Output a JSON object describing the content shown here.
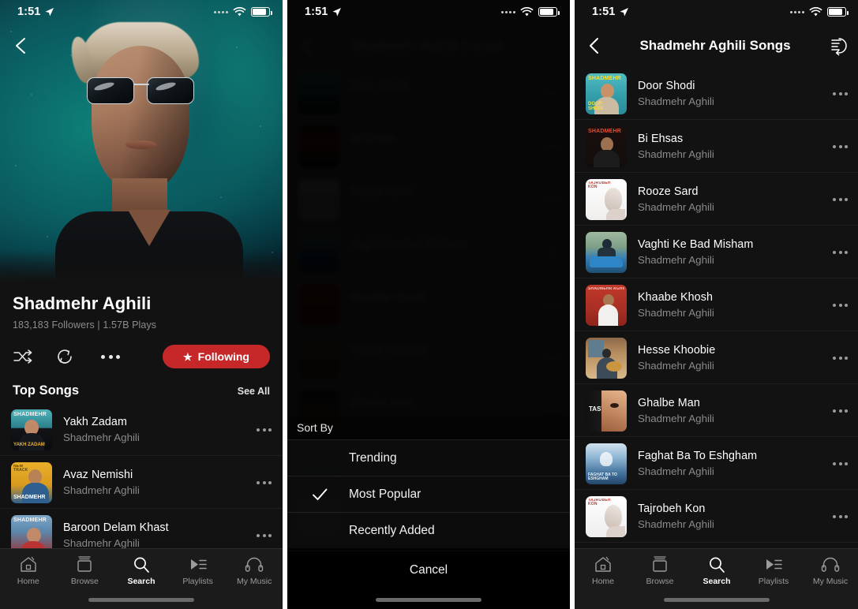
{
  "status_bar": {
    "time": "1:51",
    "location_icon": "location-arrow-icon",
    "wifi_icon": "wifi-icon",
    "battery_icon": "battery-icon"
  },
  "accent": {
    "follow_red": "#c6282a",
    "bg": "#121212",
    "tabbar": "#1b1b1b"
  },
  "panel1": {
    "back_icon": "chevron-left-icon",
    "artist_name": "Shadmehr Aghili",
    "artist_meta": "183,183 Followers | 1.57B Plays",
    "actions": {
      "shuffle_icon": "shuffle-icon",
      "repeat_icon": "repeat-icon",
      "more_icon": "more-options-icon"
    },
    "follow_button": {
      "label": "Following",
      "icon": "star-icon"
    },
    "section_title": "Top Songs",
    "see_all": "See All",
    "songs": [
      {
        "title": "Yakh Zadam",
        "artist": "Shadmehr Aghili"
      },
      {
        "title": "Avaz Nemishi",
        "artist": "Shadmehr Aghili"
      },
      {
        "title": "Baroon Delam Khast",
        "artist": "Shadmehr Aghili"
      }
    ]
  },
  "panel2": {
    "sheet_title": "Sort By",
    "options": [
      {
        "label": "Trending",
        "selected": false
      },
      {
        "label": "Most Popular",
        "selected": true
      },
      {
        "label": "Recently Added",
        "selected": false
      }
    ],
    "cancel": "Cancel"
  },
  "panel3": {
    "back_icon": "chevron-left-icon",
    "title": "Shadmehr Aghili Songs",
    "sort_icon": "sort-icon",
    "songs": [
      {
        "title": "Door Shodi",
        "artist": "Shadmehr Aghili"
      },
      {
        "title": "Bi Ehsas",
        "artist": "Shadmehr Aghili"
      },
      {
        "title": "Rooze Sard",
        "artist": "Shadmehr Aghili"
      },
      {
        "title": "Vaghti Ke Bad Misham",
        "artist": "Shadmehr Aghili"
      },
      {
        "title": "Khaabe Khosh",
        "artist": "Shadmehr Aghili"
      },
      {
        "title": "Hesse Khoobie",
        "artist": "Shadmehr Aghili"
      },
      {
        "title": "Ghalbe Man",
        "artist": "Shadmehr Aghili"
      },
      {
        "title": "Faghat Ba To Eshgham",
        "artist": "Shadmehr Aghili"
      },
      {
        "title": "Tajrobeh Kon",
        "artist": "Shadmehr Aghili"
      }
    ]
  },
  "tabbar": {
    "items": [
      {
        "label": "Home",
        "icon": "home-icon",
        "active": false
      },
      {
        "label": "Browse",
        "icon": "browse-icon",
        "active": false
      },
      {
        "label": "Search",
        "icon": "search-icon",
        "active": true
      },
      {
        "label": "Playlists",
        "icon": "playlists-icon",
        "active": false
      },
      {
        "label": "My Music",
        "icon": "my-music-icon",
        "active": false
      }
    ]
  }
}
